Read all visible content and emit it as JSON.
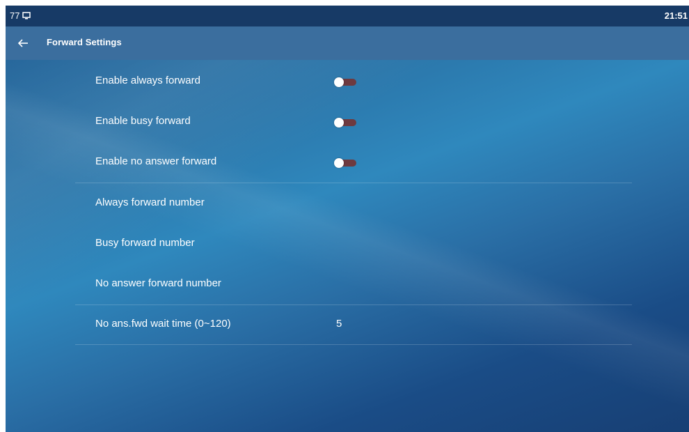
{
  "status_bar": {
    "left_text": "77",
    "monitor_icon": "monitor-icon",
    "clock": "21:51"
  },
  "header": {
    "back_icon": "back-arrow-icon",
    "title": "Forward Settings"
  },
  "settings": {
    "enable_always_forward": {
      "label": "Enable always forward",
      "enabled": false
    },
    "enable_busy_forward": {
      "label": "Enable busy forward",
      "enabled": false
    },
    "enable_no_answer_forward": {
      "label": "Enable no answer forward",
      "enabled": false
    },
    "always_forward_number": {
      "label": "Always forward number",
      "value": ""
    },
    "busy_forward_number": {
      "label": "Busy forward number",
      "value": ""
    },
    "no_answer_forward_number": {
      "label": "No answer forward number",
      "value": ""
    },
    "no_ans_fwd_wait_time": {
      "label": "No ans.fwd wait time (0~120)",
      "value": "5"
    }
  },
  "colors": {
    "status_bar": "#173a66",
    "title_bar": "#3b6e9e",
    "toggle_off_track": "#6e3a40",
    "text": "#ffffff"
  }
}
